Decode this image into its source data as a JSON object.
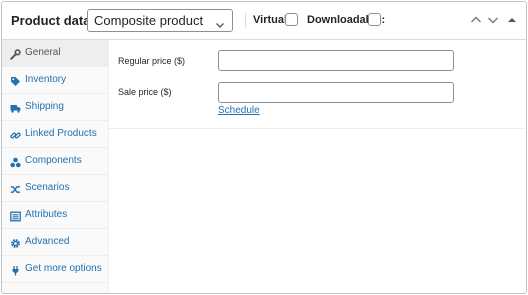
{
  "header": {
    "title": "Product data —",
    "product_type": {
      "selected": "Composite product"
    },
    "virtual_label": "Virtual:",
    "virtual_checked": false,
    "downloadable_label": "Downloadable:",
    "downloadable_checked": false
  },
  "tabs": [
    {
      "label": "General",
      "icon": "wrench-icon",
      "active": true
    },
    {
      "label": "Inventory",
      "icon": "tag-icon",
      "active": false
    },
    {
      "label": "Shipping",
      "icon": "truck-icon",
      "active": false
    },
    {
      "label": "Linked Products",
      "icon": "link-icon",
      "active": false
    },
    {
      "label": "Components",
      "icon": "components-icon",
      "active": false
    },
    {
      "label": "Scenarios",
      "icon": "shuffle-icon",
      "active": false
    },
    {
      "label": "Attributes",
      "icon": "list-icon",
      "active": false
    },
    {
      "label": "Advanced",
      "icon": "gear-icon",
      "active": false
    },
    {
      "label": "Get more options",
      "icon": "plugin-icon",
      "active": false
    }
  ],
  "general": {
    "regular_price_label": "Regular price ($)",
    "regular_price_value": "",
    "sale_price_label": "Sale price ($)",
    "sale_price_value": "",
    "schedule_link": "Schedule"
  },
  "colors": {
    "link": "#2271b1",
    "border": "#c3c4c7",
    "sidebar_bg": "#fafafa",
    "active_tab_bg": "#eeeeee",
    "text": "#1d2327"
  }
}
